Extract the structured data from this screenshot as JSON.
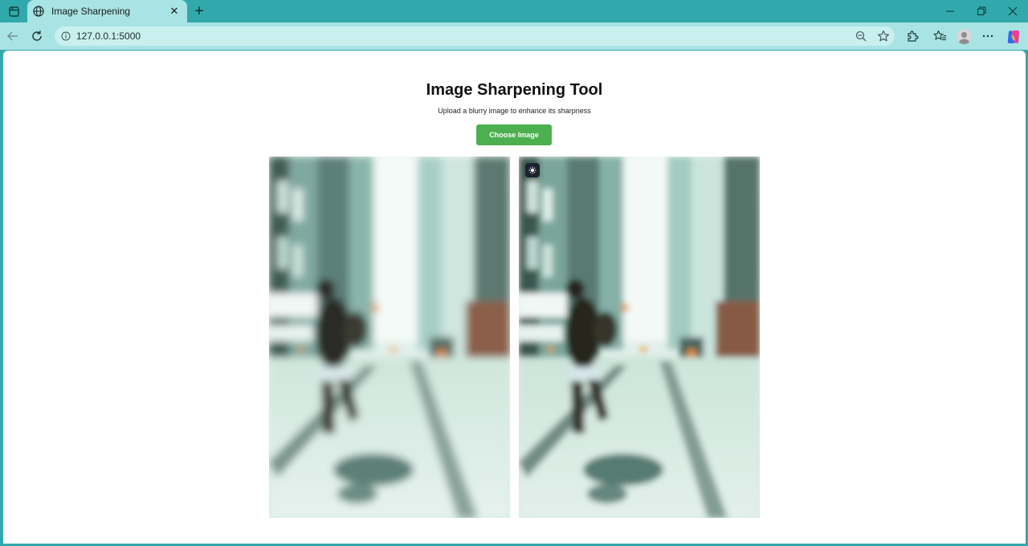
{
  "browser": {
    "tab_title": "Image Sharpening",
    "url": "127.0.0.1:5000",
    "new_tab_glyph": "+",
    "close_glyph": "✕"
  },
  "page": {
    "title": "Image Sharpening Tool",
    "subtitle": "Upload a blurry image to enhance its sharpness",
    "choose_button": "Choose Image"
  },
  "images": {
    "original": {
      "icon": "street-photo-blurry"
    },
    "sharpened": {
      "icon": "street-photo-sharpened",
      "badge_icon": "sparkle-icon"
    }
  },
  "colors": {
    "accent_button": "#4caf50",
    "browser_frame": "#31a9ac",
    "toolbar": "#a8e4e3"
  }
}
